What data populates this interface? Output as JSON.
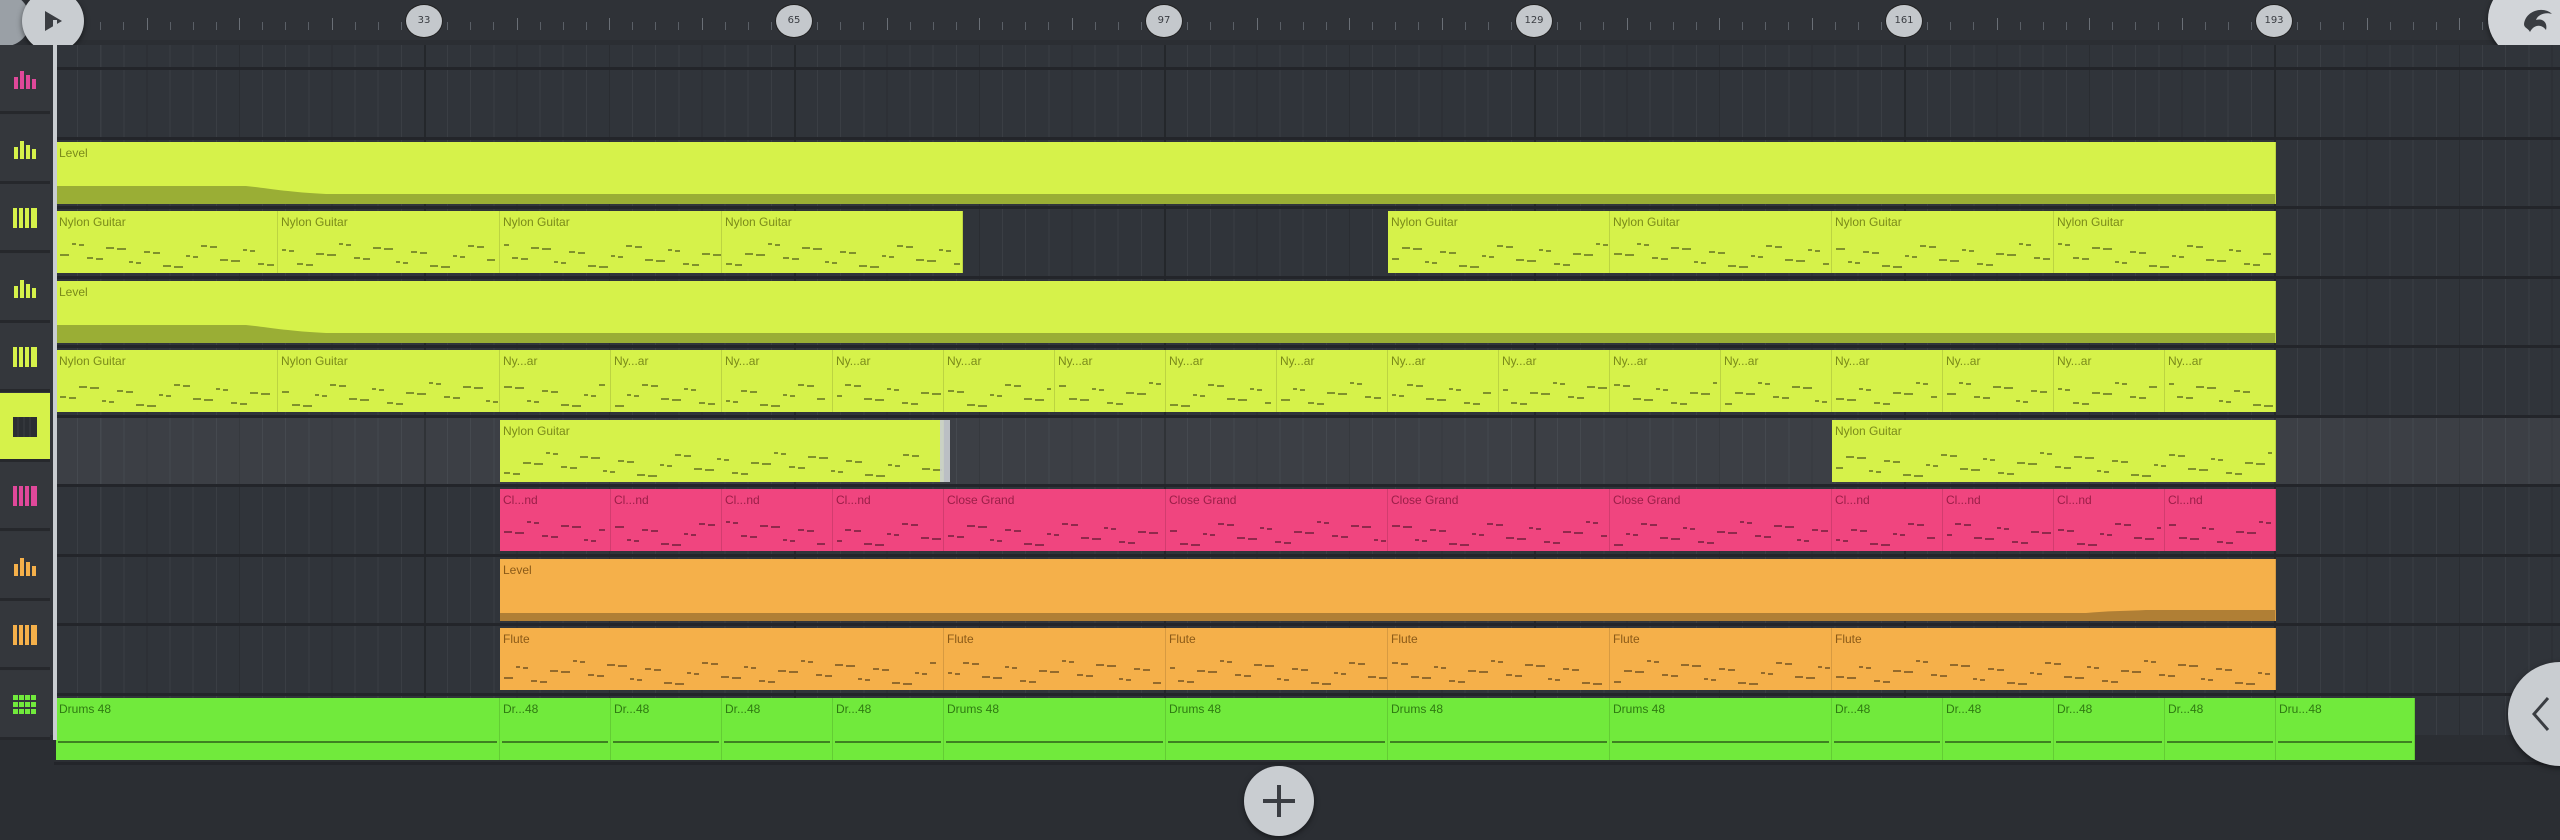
{
  "timeline": {
    "markers": [
      "33",
      "65",
      "97",
      "129",
      "161",
      "193"
    ]
  },
  "tracks": [
    {
      "icon": "automation-icon",
      "color": "#e0489a"
    },
    {
      "icon": "automation-icon",
      "color": "#d6f24a"
    },
    {
      "icon": "piano-roll-icon",
      "color": "#d6f24a"
    },
    {
      "icon": "automation-icon",
      "color": "#d6f24a"
    },
    {
      "icon": "piano-roll-icon",
      "color": "#d6f24a"
    },
    {
      "icon": "piano-roll-icon",
      "color": "#2b2e33",
      "active": true
    },
    {
      "icon": "piano-roll-icon",
      "color": "#e0489a"
    },
    {
      "icon": "automation-icon",
      "color": "#f5b04a"
    },
    {
      "icon": "piano-roll-icon",
      "color": "#f5b04a"
    },
    {
      "icon": "step-seq-icon",
      "color": "#71ea3c"
    }
  ],
  "colors": {
    "lime": "#d6f24a",
    "pink": "#f0457f",
    "orange": "#f5b04a",
    "green": "#71ea3c"
  },
  "clips": [
    {
      "lane": 1,
      "start": 0,
      "end": 24,
      "label": "Level",
      "kind": "auto",
      "color": "lime"
    },
    {
      "lane": 2,
      "start": 0,
      "end": 2.4,
      "label": "Nylon Guitar",
      "kind": "notes",
      "color": "lime"
    },
    {
      "lane": 2,
      "start": 2.4,
      "end": 4.8,
      "label": "Nylon Guitar",
      "kind": "notes",
      "color": "lime"
    },
    {
      "lane": 2,
      "start": 4.8,
      "end": 7.2,
      "label": "Nylon Guitar",
      "kind": "notes",
      "color": "lime"
    },
    {
      "lane": 2,
      "start": 7.2,
      "end": 9.8,
      "label": "Nylon Guitar",
      "kind": "notes",
      "color": "lime"
    },
    {
      "lane": 2,
      "start": 14.4,
      "end": 16.8,
      "label": "Nylon Guitar",
      "kind": "notes",
      "color": "lime"
    },
    {
      "lane": 2,
      "start": 16.8,
      "end": 19.2,
      "label": "Nylon Guitar",
      "kind": "notes",
      "color": "lime"
    },
    {
      "lane": 2,
      "start": 19.2,
      "end": 21.6,
      "label": "Nylon Guitar",
      "kind": "notes",
      "color": "lime"
    },
    {
      "lane": 2,
      "start": 21.6,
      "end": 24,
      "label": "Nylon Guitar",
      "kind": "notes",
      "color": "lime"
    },
    {
      "lane": 3,
      "start": 0,
      "end": 24,
      "label": "Level",
      "kind": "auto",
      "color": "lime"
    },
    {
      "lane": 4,
      "start": 0,
      "end": 2.4,
      "label": "Nylon Guitar",
      "kind": "notes",
      "color": "lime"
    },
    {
      "lane": 4,
      "start": 2.4,
      "end": 4.8,
      "label": "Nylon Guitar",
      "kind": "notes",
      "color": "lime"
    },
    {
      "lane": 4,
      "start": 4.8,
      "end": 6.0,
      "label": "Ny...ar",
      "kind": "notes",
      "color": "lime"
    },
    {
      "lane": 4,
      "start": 6.0,
      "end": 7.2,
      "label": "Ny...ar",
      "kind": "notes",
      "color": "lime"
    },
    {
      "lane": 4,
      "start": 7.2,
      "end": 8.4,
      "label": "Ny...ar",
      "kind": "notes",
      "color": "lime"
    },
    {
      "lane": 4,
      "start": 8.4,
      "end": 9.6,
      "label": "Ny...ar",
      "kind": "notes",
      "color": "lime"
    },
    {
      "lane": 4,
      "start": 9.6,
      "end": 10.8,
      "label": "Ny...ar",
      "kind": "notes",
      "color": "lime"
    },
    {
      "lane": 4,
      "start": 10.8,
      "end": 12.0,
      "label": "Ny...ar",
      "kind": "notes",
      "color": "lime"
    },
    {
      "lane": 4,
      "start": 12.0,
      "end": 13.2,
      "label": "Ny...ar",
      "kind": "notes",
      "color": "lime"
    },
    {
      "lane": 4,
      "start": 13.2,
      "end": 14.4,
      "label": "Ny...ar",
      "kind": "notes",
      "color": "lime"
    },
    {
      "lane": 4,
      "start": 14.4,
      "end": 15.6,
      "label": "Ny...ar",
      "kind": "notes",
      "color": "lime"
    },
    {
      "lane": 4,
      "start": 15.6,
      "end": 16.8,
      "label": "Ny...ar",
      "kind": "notes",
      "color": "lime"
    },
    {
      "lane": 4,
      "start": 16.8,
      "end": 18.0,
      "label": "Ny...ar",
      "kind": "notes",
      "color": "lime"
    },
    {
      "lane": 4,
      "start": 18.0,
      "end": 19.2,
      "label": "Ny...ar",
      "kind": "notes",
      "color": "lime"
    },
    {
      "lane": 4,
      "start": 19.2,
      "end": 20.4,
      "label": "Ny...ar",
      "kind": "notes",
      "color": "lime"
    },
    {
      "lane": 4,
      "start": 20.4,
      "end": 21.6,
      "label": "Ny...ar",
      "kind": "notes",
      "color": "lime"
    },
    {
      "lane": 4,
      "start": 21.6,
      "end": 22.8,
      "label": "Ny...ar",
      "kind": "notes",
      "color": "lime"
    },
    {
      "lane": 4,
      "start": 22.8,
      "end": 24.0,
      "label": "Ny...ar",
      "kind": "notes",
      "color": "lime"
    },
    {
      "lane": 5,
      "start": 4.8,
      "end": 9.6,
      "label": "Nylon Guitar",
      "kind": "notes",
      "color": "lime"
    },
    {
      "lane": 5,
      "start": 19.2,
      "end": 24,
      "label": "Nylon Guitar",
      "kind": "notes",
      "color": "lime"
    },
    {
      "lane": 6,
      "start": 4.8,
      "end": 6.0,
      "label": "Cl...nd",
      "kind": "notes",
      "color": "pink"
    },
    {
      "lane": 6,
      "start": 6.0,
      "end": 7.2,
      "label": "Cl...nd",
      "kind": "notes",
      "color": "pink"
    },
    {
      "lane": 6,
      "start": 7.2,
      "end": 8.4,
      "label": "Cl...nd",
      "kind": "notes",
      "color": "pink"
    },
    {
      "lane": 6,
      "start": 8.4,
      "end": 9.6,
      "label": "Cl...nd",
      "kind": "notes",
      "color": "pink"
    },
    {
      "lane": 6,
      "start": 9.6,
      "end": 12.0,
      "label": "Close Grand",
      "kind": "notes",
      "color": "pink"
    },
    {
      "lane": 6,
      "start": 12.0,
      "end": 14.4,
      "label": "Close Grand",
      "kind": "notes",
      "color": "pink"
    },
    {
      "lane": 6,
      "start": 14.4,
      "end": 16.8,
      "label": "Close Grand",
      "kind": "notes",
      "color": "pink"
    },
    {
      "lane": 6,
      "start": 16.8,
      "end": 19.2,
      "label": "Close Grand",
      "kind": "notes",
      "color": "pink"
    },
    {
      "lane": 6,
      "start": 19.2,
      "end": 20.4,
      "label": "Cl...nd",
      "kind": "notes",
      "color": "pink"
    },
    {
      "lane": 6,
      "start": 20.4,
      "end": 21.6,
      "label": "Cl...nd",
      "kind": "notes",
      "color": "pink"
    },
    {
      "lane": 6,
      "start": 21.6,
      "end": 22.8,
      "label": "Cl...nd",
      "kind": "notes",
      "color": "pink"
    },
    {
      "lane": 6,
      "start": 22.8,
      "end": 24.0,
      "label": "Cl...nd",
      "kind": "notes",
      "color": "pink"
    },
    {
      "lane": 7,
      "start": 4.8,
      "end": 24,
      "label": "Level",
      "kind": "auto2",
      "color": "orange"
    },
    {
      "lane": 8,
      "start": 4.8,
      "end": 9.6,
      "label": "Flute",
      "kind": "notes",
      "color": "orange"
    },
    {
      "lane": 8,
      "start": 9.6,
      "end": 12.0,
      "label": "Flute",
      "kind": "notes",
      "color": "orange"
    },
    {
      "lane": 8,
      "start": 12.0,
      "end": 14.4,
      "label": "Flute",
      "kind": "notes",
      "color": "orange"
    },
    {
      "lane": 8,
      "start": 14.4,
      "end": 16.8,
      "label": "Flute",
      "kind": "notes",
      "color": "orange"
    },
    {
      "lane": 8,
      "start": 16.8,
      "end": 19.2,
      "label": "Flute",
      "kind": "notes",
      "color": "orange"
    },
    {
      "lane": 8,
      "start": 19.2,
      "end": 24.0,
      "label": "Flute",
      "kind": "notes",
      "color": "orange"
    },
    {
      "lane": 9,
      "start": 0,
      "end": 4.8,
      "label": "Drums 48",
      "kind": "drum",
      "color": "green"
    },
    {
      "lane": 9,
      "start": 4.8,
      "end": 6.0,
      "label": "Dr...48",
      "kind": "drum",
      "color": "green"
    },
    {
      "lane": 9,
      "start": 6.0,
      "end": 7.2,
      "label": "Dr...48",
      "kind": "drum",
      "color": "green"
    },
    {
      "lane": 9,
      "start": 7.2,
      "end": 8.4,
      "label": "Dr...48",
      "kind": "drum",
      "color": "green"
    },
    {
      "lane": 9,
      "start": 8.4,
      "end": 9.6,
      "label": "Dr...48",
      "kind": "drum",
      "color": "green"
    },
    {
      "lane": 9,
      "start": 9.6,
      "end": 12.0,
      "label": "Drums 48",
      "kind": "drum",
      "color": "green"
    },
    {
      "lane": 9,
      "start": 12.0,
      "end": 14.4,
      "label": "Drums 48",
      "kind": "drum",
      "color": "green"
    },
    {
      "lane": 9,
      "start": 14.4,
      "end": 16.8,
      "label": "Drums 48",
      "kind": "drum",
      "color": "green"
    },
    {
      "lane": 9,
      "start": 16.8,
      "end": 19.2,
      "label": "Drums 48",
      "kind": "drum",
      "color": "green"
    },
    {
      "lane": 9,
      "start": 19.2,
      "end": 20.4,
      "label": "Dr...48",
      "kind": "drum",
      "color": "green"
    },
    {
      "lane": 9,
      "start": 20.4,
      "end": 21.6,
      "label": "Dr...48",
      "kind": "drum",
      "color": "green"
    },
    {
      "lane": 9,
      "start": 21.6,
      "end": 22.8,
      "label": "Dr...48",
      "kind": "drum",
      "color": "green"
    },
    {
      "lane": 9,
      "start": 22.8,
      "end": 24.0,
      "label": "Dr...48",
      "kind": "drum",
      "color": "green"
    },
    {
      "lane": 9,
      "start": 24.0,
      "end": 25.5,
      "label": "Dru...48",
      "kind": "drum",
      "color": "green"
    }
  ]
}
